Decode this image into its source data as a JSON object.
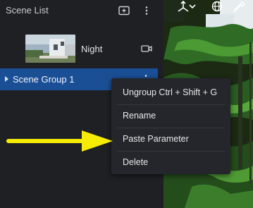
{
  "panel": {
    "title": "Scene List"
  },
  "scenes": [
    {
      "name": "Night"
    }
  ],
  "group": {
    "label": "Scene Group 1"
  },
  "context_menu": {
    "items": [
      {
        "label": "Ungroup Ctrl + Shift + G"
      },
      {
        "label": "Rename"
      },
      {
        "label": "Paste Parameter"
      },
      {
        "label": "Delete"
      }
    ]
  },
  "icons": {
    "header_add": "add-scene-icon",
    "header_more": "more-vertical-icon",
    "camera": "camera-icon",
    "viewport_tools": [
      "axis-gizmo-icon",
      "chevron-down-icon",
      "globe-icon",
      "eyedropper-icon"
    ]
  },
  "colors": {
    "selection": "#1b4f95",
    "annotation_arrow": "#f5ec00"
  }
}
